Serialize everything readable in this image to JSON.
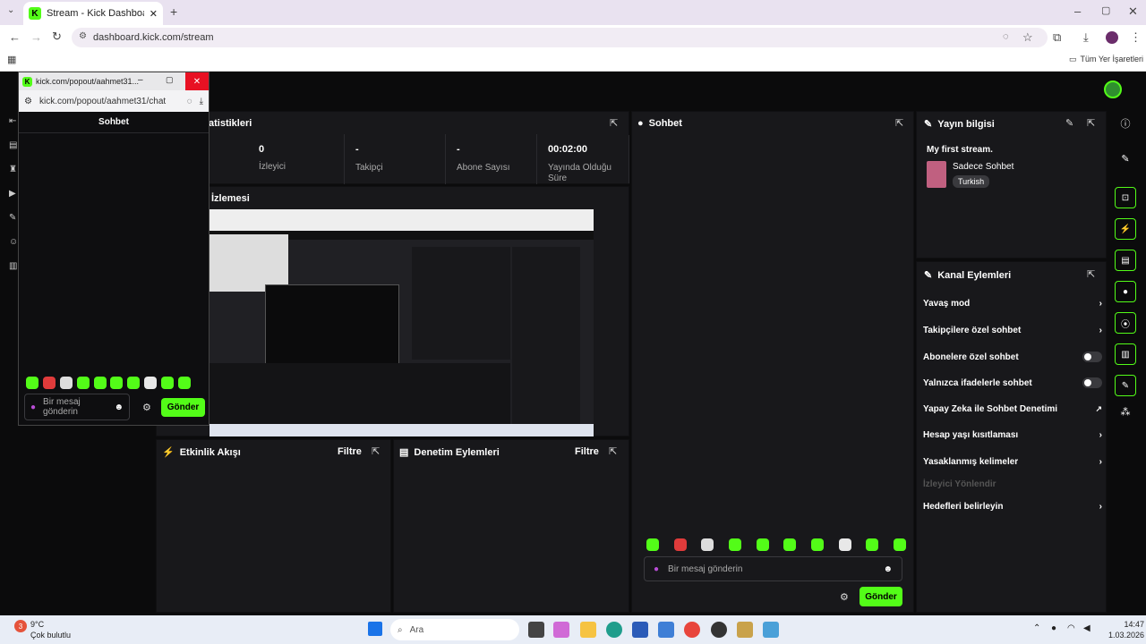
{
  "browser": {
    "tab_title": "Stream - Kick Dashboard",
    "url": "dashboard.kick.com/stream",
    "bookmarks": "Tüm Yer İşaretleri"
  },
  "popout": {
    "title": "kick.com/popout/aahmet31...",
    "url": "kick.com/popout/aahmet31/chat",
    "header": "Sohbet",
    "placeholder": "Bir mesaj gönderin",
    "send": "Gönder"
  },
  "stats": {
    "title": "atistikleri",
    "items": [
      {
        "value": "0",
        "label": "İzleyici"
      },
      {
        "value": "-",
        "label": "Takipçi"
      },
      {
        "value": "-",
        "label": "Abone Sayısı"
      },
      {
        "value": "00:02:00",
        "label": "Yayında Olduğu Süre"
      }
    ]
  },
  "preview": {
    "title": "İzlemesi"
  },
  "chat": {
    "title": "Sohbet",
    "placeholder": "Bir mesaj gönderin",
    "send": "Gönder"
  },
  "stream_info": {
    "title": "Yayın bilgisi",
    "stream_title": "My first stream.",
    "category": "Sadece Sohbet",
    "language": "Turkish"
  },
  "channel_actions": {
    "title": "Kanal Eylemleri",
    "items": [
      {
        "label": "Yavaş mod",
        "kind": "arrow"
      },
      {
        "label": "Takipçilere özel sohbet",
        "kind": "arrow"
      },
      {
        "label": "Abonelere özel sohbet",
        "kind": "toggle"
      },
      {
        "label": "Yalnızca ifadelerle sohbet",
        "kind": "toggle"
      },
      {
        "label": "Yapay Zeka ile Sohbet Denetimi",
        "kind": "external"
      },
      {
        "label": "Hesap yaşı kısıtlaması",
        "kind": "arrow"
      },
      {
        "label": "Yasaklanmış kelimeler",
        "kind": "arrow"
      },
      {
        "label": "İzleyici Yönlendir",
        "kind": "disabled"
      },
      {
        "label": "Hedefleri belirleyin",
        "kind": "arrow"
      }
    ]
  },
  "activity": {
    "title": "Etkinlik Akışı",
    "filter": "Filtre"
  },
  "moderation": {
    "title": "Denetim Eylemleri",
    "filter": "Filtre"
  },
  "taskbar": {
    "weather_temp": "9°C",
    "weather_desc": "Çok bulutlu",
    "weather_badge": "3",
    "search": "Ara",
    "time": "14:47",
    "date": "1.03.2026"
  },
  "colors": {
    "accent": "#53fc18",
    "panel": "#18181b",
    "background": "#0b0b0c"
  }
}
